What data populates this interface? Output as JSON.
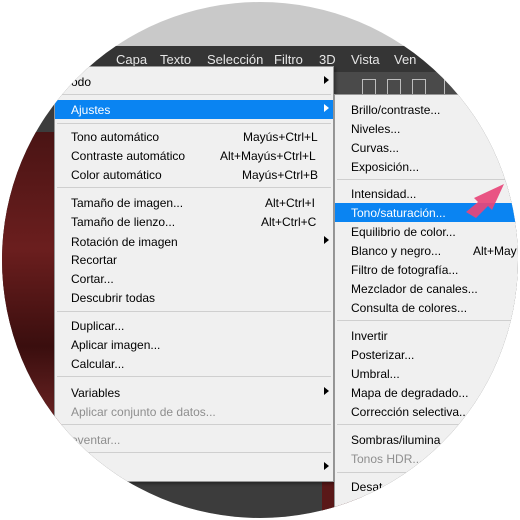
{
  "menubar": [
    "Capa",
    "Texto",
    "Selección",
    "Filtro",
    "3D",
    "Vista",
    "Ven"
  ],
  "image_menu": {
    "items": [
      {
        "label": "odo",
        "shortcut": "",
        "arrow": true
      },
      {
        "label": "Ajustes",
        "shortcut": "",
        "arrow": true,
        "highlight": true
      },
      {
        "label": "Tono automático",
        "shortcut": "Mayús+Ctrl+L"
      },
      {
        "label": "Contraste automático",
        "shortcut": "Alt+Mayús+Ctrl+L"
      },
      {
        "label": "Color automático",
        "shortcut": "Mayús+Ctrl+B"
      },
      {
        "label": "Tamaño de imagen...",
        "shortcut": "Alt+Ctrl+I"
      },
      {
        "label": "Tamaño de lienzo...",
        "shortcut": "Alt+Ctrl+C"
      },
      {
        "label": "Rotación de imagen",
        "shortcut": "",
        "arrow": true
      },
      {
        "label": "Recortar",
        "shortcut": ""
      },
      {
        "label": "Cortar...",
        "shortcut": ""
      },
      {
        "label": "Descubrir todas",
        "shortcut": ""
      },
      {
        "label": "Duplicar...",
        "shortcut": ""
      },
      {
        "label": "Aplicar imagen...",
        "shortcut": ""
      },
      {
        "label": "Calcular...",
        "shortcut": ""
      },
      {
        "label": "Variables",
        "shortcut": "",
        "arrow": true
      },
      {
        "label": "Aplicar conjunto de datos...",
        "shortcut": "",
        "disabled": true
      },
      {
        "label": "eventar...",
        "shortcut": "",
        "disabled": true
      },
      {
        "label": "",
        "shortcut": "",
        "arrow": true
      }
    ]
  },
  "ajustes_menu": {
    "items": [
      {
        "label": "Brillo/contraste..."
      },
      {
        "label": "Niveles..."
      },
      {
        "label": "Curvas..."
      },
      {
        "label": "Exposición..."
      },
      {
        "label": "Intensidad..."
      },
      {
        "label": "Tono/saturación...",
        "highlight": true
      },
      {
        "label": "Equilibrio de color..."
      },
      {
        "label": "Blanco y negro...",
        "shortcut": "Alt+May"
      },
      {
        "label": "Filtro de fotografía..."
      },
      {
        "label": "Mezclador de canales..."
      },
      {
        "label": "Consulta de colores..."
      },
      {
        "label": "Invertir"
      },
      {
        "label": "Posterizar..."
      },
      {
        "label": "Umbral..."
      },
      {
        "label": "Mapa de degradado..."
      },
      {
        "label": "Corrección selectiva..."
      },
      {
        "label": "Sombras/ilumina"
      },
      {
        "label": "Tonos HDR...",
        "disabled": true
      },
      {
        "label": "Desat"
      }
    ]
  },
  "colors": {
    "highlight": "#0a84f2",
    "pointer": "#e8467a",
    "menubar": "#353535"
  }
}
